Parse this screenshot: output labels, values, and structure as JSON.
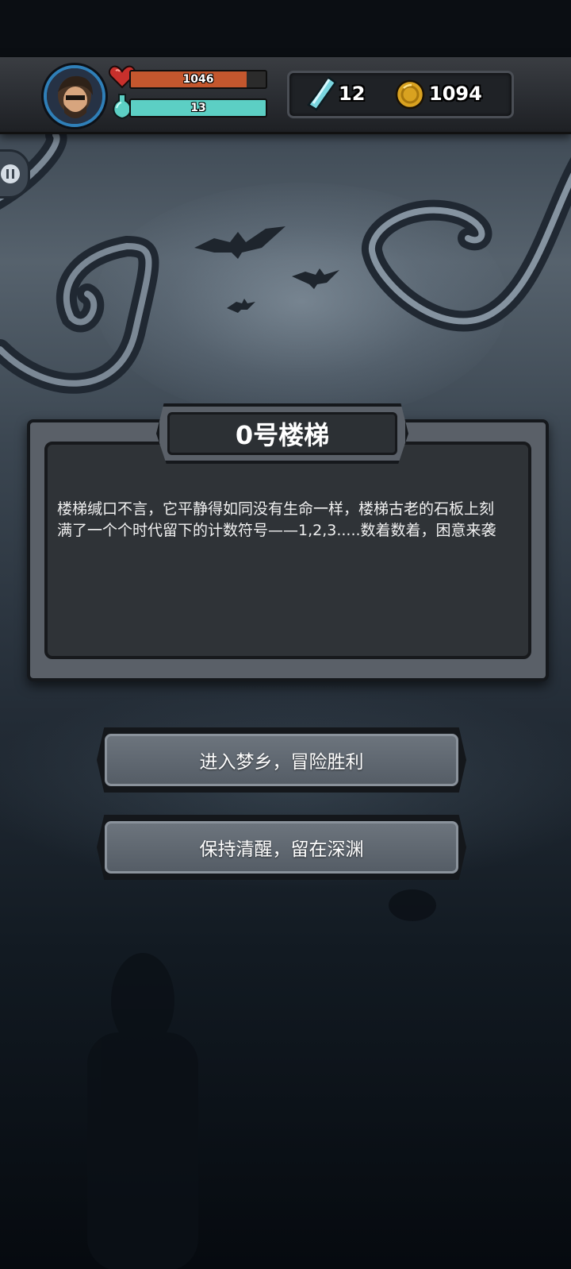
{
  "hud": {
    "health_value": "1046",
    "health_fraction": 0.86,
    "mana_value": "13",
    "mana_fraction": 1.0,
    "crystals": "12",
    "coins": "1094"
  },
  "dialog": {
    "title": "0号楼梯",
    "body": "楼梯缄口不言，它平静得如同没有生命一样，楼梯古老的石板上刻满了一个个时代留下的计数符号——1,2,3.....数着数着，困意来袭"
  },
  "choices": [
    {
      "label": "进入梦乡，冒险胜利"
    },
    {
      "label": "保持清醒，留在深渊"
    }
  ],
  "colors": {
    "health": "#c4572e",
    "mana": "#5ccfc4",
    "avatar_ring": "#2f7fb8",
    "coin": "#d9a220",
    "crystal": "#7ad6e0"
  }
}
